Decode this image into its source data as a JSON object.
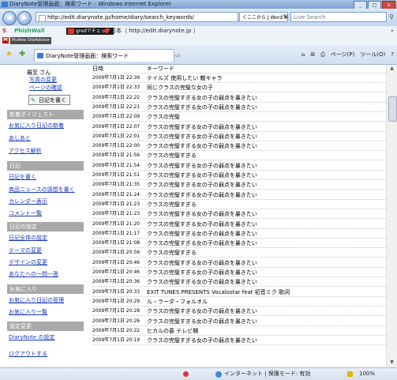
{
  "window": {
    "title": "DiaryNote管理画面：検索ワード - Windows Internet Explorer",
    "buttons": [
      "_",
      "□",
      "x"
    ]
  },
  "address": {
    "url": "http://edit.diarynote.jp/home/diary/search_keywords/",
    "middle_box": "くここから J Word 検索",
    "live_search_placeholder": "Live Search"
  },
  "links_bar": {
    "s_label": "S",
    "phishwall": "PhishWall",
    "gred": "gredでチェック",
    "japan_site": "日本（ http://edit.diarynote.jp ）"
  },
  "mcafee": {
    "label": "M",
    "site_advisor": "McAfee SiteAdvisor"
  },
  "tab": {
    "title": "DiaryNote管理画面：検索ワード"
  },
  "tools": {
    "page": "ページ(P)",
    "tools": "ツール(O)"
  },
  "sidebar": {
    "username": "羅至 さん",
    "photo_change": "写真の変更",
    "page_confirm": "ページの確認",
    "write_diary": "日記を書く",
    "sections": [
      {
        "title": "新着ダイジェスト",
        "items": [
          "お気に入り日記の新着",
          "あしあと",
          "アクセス解析"
        ]
      },
      {
        "title": "日記",
        "items": [
          "日記を書く",
          "商品ニュースの感想を書く",
          "カレンダー表示",
          "コメント一覧"
        ]
      },
      {
        "title": "日記の設定",
        "items": [
          "日記全体の設定",
          "テーマの変更",
          "デザインの変更",
          "あなたへの一問一答"
        ]
      },
      {
        "title": "お気に入り",
        "items": [
          "お気に入り日記の管理",
          "お気に入り一覧"
        ]
      },
      {
        "title": "設定変更",
        "items": [
          "DiaryNote の設定"
        ]
      }
    ],
    "logout": "ログアウトする"
  },
  "table": {
    "headers": [
      "日時",
      "キーワード"
    ],
    "rows": [
      [
        "2009年7月1日 22:39",
        "テイルズ 使用したい 敵キャラ"
      ],
      [
        "2009年7月1日 22:33",
        "同じクラスの完璧な女の子"
      ],
      [
        "2009年7月1日 22:22",
        "クラスの完璧すぎる女の子の弱点を暴きたい"
      ],
      [
        "2009年7月1日 22:21",
        "クラスの完璧すぎる女の子の弱点を暴きたい"
      ],
      [
        "2009年7月1日 22:09",
        "クラスの完璧"
      ],
      [
        "2009年7月1日 22:07",
        "クラスの完璧すぎる女の子の弱点を暴きたい"
      ],
      [
        "2009年7月1日 22:01",
        "クラスの完璧すぎる女の子の弱点を暴きたい"
      ],
      [
        "2009年7月1日 22:00",
        "クラスの完璧すぎる女の子の弱点を暴きたい"
      ],
      [
        "2009年7月1日 21:56",
        "クラスの完璧すぎる"
      ],
      [
        "2009年7月1日 21:54",
        "クラスの完璧すぎる女の子の弱点を暴きたい"
      ],
      [
        "2009年7月1日 21:51",
        "クラスの完璧すぎる女の子の弱点を暴きたい"
      ],
      [
        "2009年7月1日 21:35",
        "クラスの完璧すぎる女の子の弱点を暴きたい"
      ],
      [
        "2009年7月1日 21:24",
        "クラスの完璧すぎる女の子の弱点を暴きたい"
      ],
      [
        "2009年7月1日 21:23",
        "クラスの完璧すぎる"
      ],
      [
        "2009年7月1日 21:23",
        "クラスの完璧すぎる女の子の弱点を暴きたい"
      ],
      [
        "2009年7月1日 21:20",
        "クラスの完璧すぎる女の子の弱点を暴きたい"
      ],
      [
        "2009年7月1日 21:17",
        "クラスの完璧すぎる女の子の弱点を暴きたい"
      ],
      [
        "2009年7月1日 21:08",
        "クラスの完璧すぎる女の子の弱点を暴きたい"
      ],
      [
        "2009年7月1日 20:56",
        "クラスの完璧すぎる"
      ],
      [
        "2009年7月1日 20:46",
        "クラスの完璧すぎる女の子の弱点を暴きたい"
      ],
      [
        "2009年7月1日 20:46",
        "クラスの完璧すぎる女の子の弱点を暴きたい"
      ],
      [
        "2009年7月1日 20:36",
        "クラスの完璧すぎる女の子の弱点を暴きたい"
      ],
      [
        "2009年7月1日 20:33",
        "EXIT TUNES PRESENTS Vocalostar feat 初音ミク 歌詞"
      ],
      [
        "2009年7月1日 20:29",
        "ル・ラーダ・フォルオル"
      ],
      [
        "2009年7月1日 20:28",
        "クラスの完璧すぎる女の子の弱点を暴きたい"
      ],
      [
        "2009年7月1日 20:26",
        "クラスの完璧すぎる女の子の弱点を暴きたい"
      ],
      [
        "2009年7月1日 20:22",
        "ヒカルの碁 テレビ欄"
      ],
      [
        "2009年7月1日 20:19",
        "クラスの完璧すぎる女の子の弱点を暴きたい"
      ]
    ]
  },
  "status": {
    "zone": "インターネット | 保護モード: 有効",
    "zoom": "100%"
  }
}
